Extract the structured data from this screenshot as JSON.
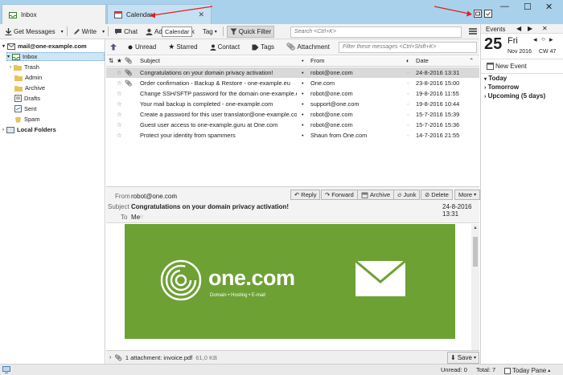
{
  "tabs": [
    {
      "label": "Inbox",
      "icon": "inbox-icon"
    },
    {
      "label": "Calendar",
      "icon": "calendar-icon"
    }
  ],
  "toolbar": {
    "get_messages": "Get Messages",
    "write": "Write",
    "chat": "Chat",
    "address_book": "Address Book",
    "tooltip": "Calendar",
    "tag": "Tag",
    "quick_filter": "Quick Filter",
    "search_placeholder": "Search <Ctrl+K>"
  },
  "folders": {
    "account": "mail@one-example.com",
    "items": [
      "Inbox",
      "Trash",
      "Admin",
      "Archive",
      "Drafts",
      "Sent",
      "Spam"
    ],
    "local": "Local Folders"
  },
  "quickfilter": {
    "unread": "Unread",
    "starred": "Starred",
    "contact": "Contact",
    "tags": "Tags",
    "attachment": "Attachment",
    "filter_placeholder": "Filter these messages <Ctrl+Shift+K>"
  },
  "thread_columns": {
    "subject": "Subject",
    "from": "From",
    "date": "Date"
  },
  "messages": [
    {
      "subject": "Congratulations on your domain privacy activation!",
      "from": "robot@one.com",
      "date": "24-8-2016 13:31"
    },
    {
      "subject": "Order confirmation - Backup & Restore - one-example.eu",
      "from": "One.com",
      "date": "23-8-2016 15:00"
    },
    {
      "subject": "Change SSH/SFTP password for the domain one-example.eu",
      "from": "robot@one.com",
      "date": "19-8-2016 11:55"
    },
    {
      "subject": "Your mail backup is completed - one-example.com",
      "from": "support@one.com",
      "date": "19-8-2016 10:44"
    },
    {
      "subject": "Create a password for this user translator@one-example.com",
      "from": "robot@one.com",
      "date": "15-7-2016 15:39"
    },
    {
      "subject": "Guest user access to one-example.guru at One.com",
      "from": "robot@one.com",
      "date": "15-7-2016 15:36"
    },
    {
      "subject": "Protect your identity from spammers",
      "from": "Shaun from One.com",
      "date": "14-7-2016 21:55"
    }
  ],
  "message_header": {
    "from_label": "From",
    "from_value": "robot@one.com",
    "subject_label": "Subject",
    "subject_value": "Congratulations on your domain privacy activation!",
    "to_label": "To",
    "to_value": "Me",
    "date": "24-8-2016 13:31",
    "reply": "Reply",
    "forward": "Forward",
    "archive": "Archive",
    "junk": "Junk",
    "delete": "Delete",
    "more": "More"
  },
  "banner": {
    "brand": "one.com",
    "tagline": "Domain • Hosting • E-mail"
  },
  "attachment": {
    "label": "1 attachment: invoice.pdf",
    "size": "61,0 KB",
    "save": "Save"
  },
  "today_pane": {
    "header": "Events",
    "day": "25",
    "weekday": "Fri",
    "month_year": "Nov 2016",
    "week": "CW 47",
    "new_event": "New Event",
    "sections": [
      "Today",
      "Tomorrow",
      "Upcoming (5 days)"
    ]
  },
  "status": {
    "unread": "Unread: 0",
    "total": "Total: 7",
    "today_pane": "Today Pane"
  },
  "colors": {
    "titlebar": "#a9d1ec",
    "banner": "#6da133",
    "arrow": "#e02020"
  }
}
